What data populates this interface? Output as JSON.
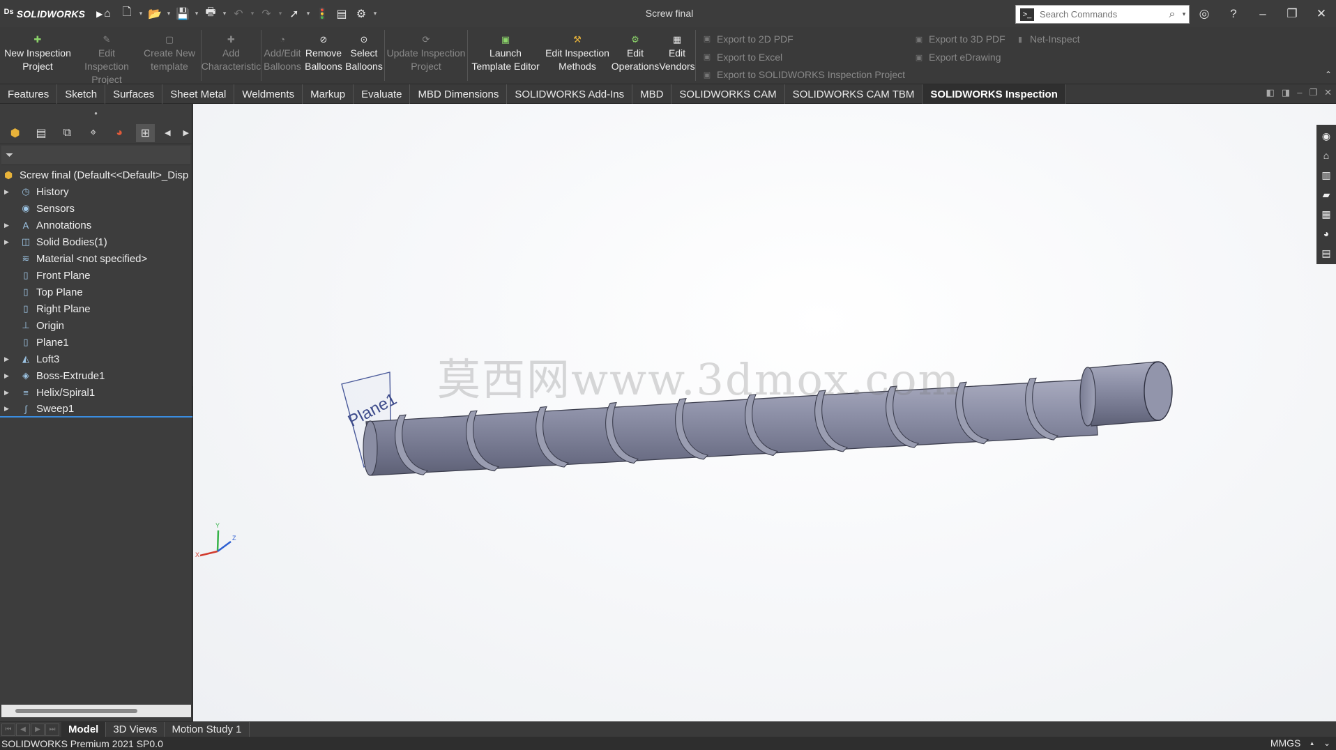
{
  "app": {
    "logo": "SOLIDWORKS",
    "document_title": "Screw final"
  },
  "quick_access": [
    "home-icon",
    "new-icon",
    "open-icon",
    "save-icon",
    "print-icon",
    "undo-icon",
    "redo-icon",
    "select-icon",
    "rebuild-icon",
    "file-properties-icon",
    "options-icon"
  ],
  "search": {
    "placeholder": "Search Commands"
  },
  "ribbon": {
    "buttons": [
      {
        "id": "new-inspection-project",
        "label": "New Inspection\nProject",
        "enabled": true
      },
      {
        "id": "edit-inspection-project",
        "label": "Edit Inspection\nProject",
        "enabled": false
      },
      {
        "id": "create-new-template",
        "label": "Create New\ntemplate",
        "enabled": false
      },
      {
        "id": "add-characteristic",
        "label": "Add\nCharacteristic",
        "enabled": false
      },
      {
        "id": "add-edit-balloons",
        "label": "Add/Edit\nBalloons",
        "enabled": false
      },
      {
        "id": "remove-balloons",
        "label": "Remove\nBalloons",
        "enabled": true
      },
      {
        "id": "select-balloons",
        "label": "Select\nBalloons",
        "enabled": true
      },
      {
        "id": "update-inspection-project",
        "label": "Update Inspection\nProject",
        "enabled": false
      },
      {
        "id": "launch-template-editor",
        "label": "Launch\nTemplate Editor",
        "enabled": true
      },
      {
        "id": "edit-inspection-methods",
        "label": "Edit Inspection\nMethods",
        "enabled": true
      },
      {
        "id": "edit-operations",
        "label": "Edit\nOperations",
        "enabled": true
      },
      {
        "id": "edit-vendors",
        "label": "Edit\nVendors",
        "enabled": true
      }
    ],
    "export_col1": [
      "Export to 2D PDF",
      "Export to Excel",
      "Export to SOLIDWORKS Inspection Project"
    ],
    "export_col2": [
      "Export to 3D PDF",
      "Export eDrawing"
    ],
    "export_col3": [
      "Net-Inspect"
    ]
  },
  "tabs": [
    "Features",
    "Sketch",
    "Surfaces",
    "Sheet Metal",
    "Weldments",
    "Markup",
    "Evaluate",
    "MBD Dimensions",
    "SOLIDWORKS Add-Ins",
    "MBD",
    "SOLIDWORKS CAM",
    "SOLIDWORKS CAM TBM",
    "SOLIDWORKS Inspection"
  ],
  "active_tab": "SOLIDWORKS Inspection",
  "feature_tree": {
    "root": "Screw final  (Default<<Default>_Disp",
    "items": [
      {
        "label": "History",
        "expandable": true,
        "icon": "history-icon"
      },
      {
        "label": "Sensors",
        "expandable": false,
        "icon": "sensors-icon"
      },
      {
        "label": "Annotations",
        "expandable": true,
        "icon": "annotations-icon"
      },
      {
        "label": "Solid Bodies(1)",
        "expandable": true,
        "icon": "solid-bodies-icon"
      },
      {
        "label": "Material <not specified>",
        "expandable": false,
        "icon": "material-icon"
      },
      {
        "label": "Front Plane",
        "expandable": false,
        "icon": "plane-icon"
      },
      {
        "label": "Top Plane",
        "expandable": false,
        "icon": "plane-icon"
      },
      {
        "label": "Right Plane",
        "expandable": false,
        "icon": "plane-icon"
      },
      {
        "label": "Origin",
        "expandable": false,
        "icon": "origin-icon"
      },
      {
        "label": "Plane1",
        "expandable": false,
        "icon": "plane-icon"
      },
      {
        "label": "Loft3",
        "expandable": true,
        "icon": "loft-icon"
      },
      {
        "label": "Boss-Extrude1",
        "expandable": true,
        "icon": "extrude-icon"
      },
      {
        "label": "Helix/Spiral1",
        "expandable": true,
        "icon": "helix-icon"
      },
      {
        "label": "Sweep1",
        "expandable": true,
        "icon": "sweep-icon",
        "selected": true
      }
    ]
  },
  "viewport": {
    "plane_label": "Plane1",
    "watermark": "莫西网www.3dmox.com",
    "triad": {
      "x": "X",
      "y": "Y",
      "z": "Z"
    }
  },
  "bottom_tabs": [
    "Model",
    "3D Views",
    "Motion Study 1"
  ],
  "active_bottom_tab": "Model",
  "status": {
    "left": "SOLIDWORKS Premium 2021 SP0.0",
    "units": "MMGS"
  },
  "colors": {
    "ui_dark": "#3a3a3a",
    "part_body": "#8c8fa6",
    "selection_blue": "#3a8de0"
  }
}
